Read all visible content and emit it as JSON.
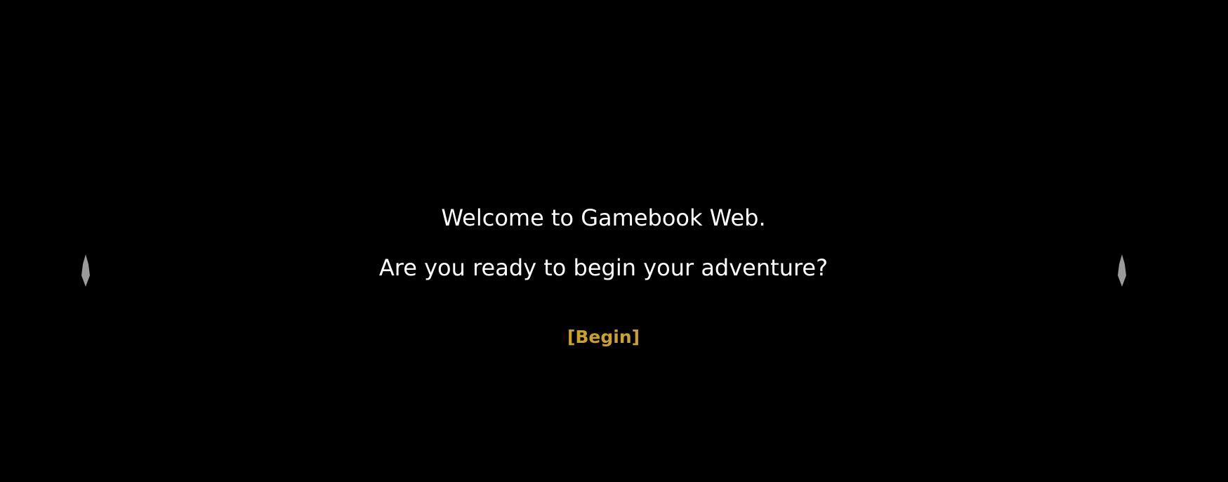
{
  "intro": {
    "welcome_text": "Welcome to Gamebook Web.",
    "prompt_text": "Are you ready to begin your adventure?",
    "begin_label": "[Begin]"
  },
  "colors": {
    "background": "#000000",
    "text": "#ffffff",
    "link": "#c9a227",
    "marker": "#9a9a9a"
  },
  "icons": {
    "left_marker": "crystal-shard-icon",
    "right_marker": "crystal-shard-icon"
  }
}
